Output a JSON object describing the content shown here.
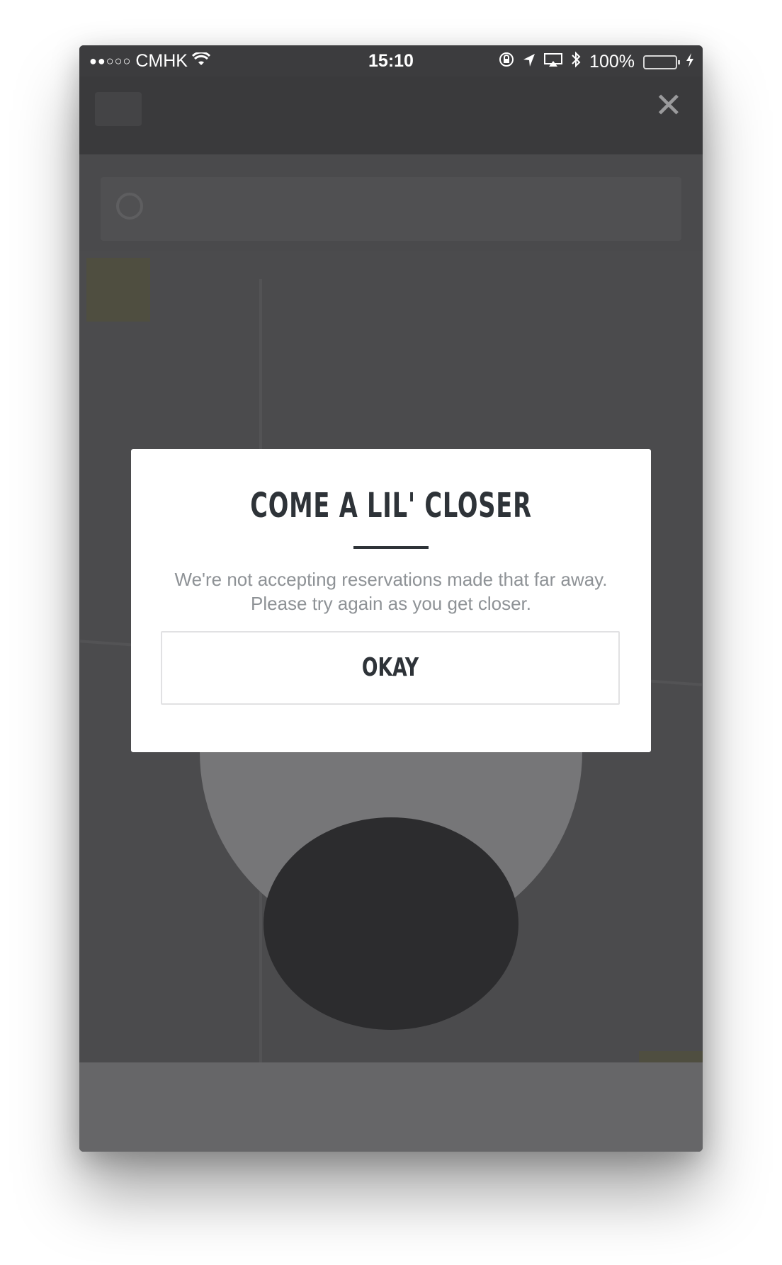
{
  "status_bar": {
    "signal": "●●○○○",
    "carrier": "CMHK",
    "time": "15:10",
    "battery_percent": "100%",
    "battery_level": 1.0,
    "icons": [
      "wifi-icon",
      "rotation-lock-icon",
      "location-arrow-icon",
      "airplay-icon",
      "bluetooth-icon",
      "charging-bolt-icon"
    ]
  },
  "dialog": {
    "title": "COME A LIL' CLOSER",
    "message": "We're not accepting reservations made that far away.  Please try again as you get closer.",
    "button_label": "OKAY"
  },
  "colors": {
    "overlay_background": "#4a4a4c",
    "dialog_background": "#ffffff",
    "title_text": "#2e3338",
    "message_text": "#8e9296",
    "battery_green": "#4cd964"
  }
}
